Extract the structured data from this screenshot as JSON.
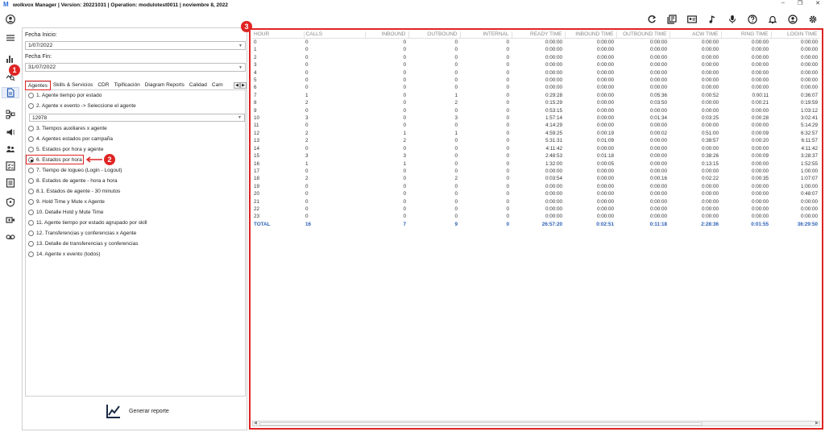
{
  "window": {
    "title": "wolkvox Manager  | Version: 20221031 |  Operation: modulotest0011  |  noviembre 8, 2022",
    "logo_letter": "M"
  },
  "toolbar_icons": [
    "refresh-icon",
    "library-icon",
    "contact-card-icon",
    "music-note-icon",
    "microphone-icon",
    "help-icon",
    "bell-icon",
    "user-icon",
    "settings-icon"
  ],
  "rail_icons": [
    "user-avatar-icon",
    "menu-icon",
    "bar-chart-icon",
    "search-analytics-icon",
    "reports-icon",
    "flow-icon",
    "megaphone-icon",
    "team-icon",
    "checklist-icon",
    "table-icon",
    "security-icon",
    "video-icon",
    "voicemail-icon"
  ],
  "filters": {
    "start_label": "Fecha Inicio:",
    "start_value": "1/07/2022",
    "end_label": "Fecha Fin:",
    "end_value": "31/07/2022"
  },
  "tabs": [
    "Agentes",
    "Skills & Servicios",
    "CDR",
    "Tipificación",
    "Diagram Reports",
    "Calidad",
    "Cam"
  ],
  "reports": {
    "options": [
      "1. Agente tiempo por estado",
      "2. Agente x evento -> Seleccione el agente",
      "3. Tiempos auxiliares x agente",
      "4. Agentes estados por campaña",
      "5. Estados por hora y agente",
      "6. Estados por hora",
      "7. Tiempo de logueo (Login - Logout)",
      "8. Estados de agente - hora a hora",
      "8.1. Estados de agente - 30 minutos",
      "9. Hold Time y Mute x Agente",
      "10. Detalle Hold y Mute Time",
      "11. Agente tiempo por estado agrupado por skill",
      "12. Transferencias y conferencias x Agente",
      "13. Detalle de transferencias y conferencias",
      "14. Agente x evento (todos)"
    ],
    "selected_index": 5,
    "agent_value": "12978"
  },
  "generate_label": "Generar reporte",
  "callouts": [
    "1",
    "2",
    "3"
  ],
  "grid": {
    "headers": [
      "HOUR",
      "CALLS",
      "INBOUND",
      "OUTBOUND",
      "INTERNAL",
      "READY TIME",
      "INBOUND TIME",
      "OUTBOUND TIME",
      "ACW TIME",
      "RING TIME",
      "LOGIN TIME"
    ],
    "rows": [
      [
        "0",
        "0",
        "0",
        "0",
        "0",
        "0:00:00",
        "0:00:00",
        "0:00:00",
        "0:00:00",
        "0:00:00",
        "0:00:00"
      ],
      [
        "1",
        "0",
        "0",
        "0",
        "0",
        "0:00:00",
        "0:00:00",
        "0:00:00",
        "0:00:00",
        "0:00:00",
        "0:00:00"
      ],
      [
        "2",
        "0",
        "0",
        "0",
        "0",
        "0:00:00",
        "0:00:00",
        "0:00:00",
        "0:00:00",
        "0:00:00",
        "0:00:00"
      ],
      [
        "3",
        "0",
        "0",
        "0",
        "0",
        "0:00:00",
        "0:00:00",
        "0:00:00",
        "0:00:00",
        "0:00:00",
        "0:00:00"
      ],
      [
        "4",
        "0",
        "0",
        "0",
        "0",
        "0:00:00",
        "0:00:00",
        "0:00:00",
        "0:00:00",
        "0:00:00",
        "0:00:00"
      ],
      [
        "5",
        "0",
        "0",
        "0",
        "0",
        "0:00:00",
        "0:00:00",
        "0:00:00",
        "0:00:00",
        "0:00:00",
        "0:00:00"
      ],
      [
        "6",
        "0",
        "0",
        "0",
        "0",
        "0:00:00",
        "0:00:00",
        "0:00:00",
        "0:00:00",
        "0:00:00",
        "0:00:00"
      ],
      [
        "7",
        "1",
        "0",
        "1",
        "0",
        "0:29:28",
        "0:00:00",
        "0:05:36",
        "0:00:52",
        "0:00:11",
        "0:36:07"
      ],
      [
        "8",
        "2",
        "0",
        "2",
        "0",
        "0:15:29",
        "0:00:00",
        "0:03:50",
        "0:00:00",
        "0:00:21",
        "0:19:59"
      ],
      [
        "9",
        "0",
        "0",
        "0",
        "0",
        "0:53:15",
        "0:00:00",
        "0:00:00",
        "0:00:00",
        "0:00:00",
        "1:03:12"
      ],
      [
        "10",
        "3",
        "0",
        "3",
        "0",
        "1:57:14",
        "0:00:00",
        "0:01:34",
        "0:03:25",
        "0:00:28",
        "3:02:41"
      ],
      [
        "11",
        "0",
        "0",
        "0",
        "0",
        "4:14:29",
        "0:00:00",
        "0:00:00",
        "0:00:00",
        "0:00:00",
        "5:14:29"
      ],
      [
        "12",
        "2",
        "1",
        "1",
        "0",
        "4:59:25",
        "0:00:19",
        "0:00:02",
        "0:51:00",
        "0:00:09",
        "6:32:57"
      ],
      [
        "13",
        "2",
        "2",
        "0",
        "0",
        "5:31:31",
        "0:01:09",
        "0:00:00",
        "0:38:57",
        "0:00:20",
        "6:11:57"
      ],
      [
        "14",
        "0",
        "0",
        "0",
        "0",
        "4:11:42",
        "0:00:00",
        "0:00:00",
        "0:00:00",
        "0:00:00",
        "4:11:42"
      ],
      [
        "15",
        "3",
        "3",
        "0",
        "0",
        "2:48:53",
        "0:01:18",
        "0:00:00",
        "0:38:26",
        "0:00:09",
        "3:28:37"
      ],
      [
        "16",
        "1",
        "1",
        "0",
        "0",
        "1:32:00",
        "0:00:05",
        "0:00:00",
        "0:13:15",
        "0:00:00",
        "1:52:55"
      ],
      [
        "17",
        "0",
        "0",
        "0",
        "0",
        "0:00:00",
        "0:00:00",
        "0:00:00",
        "0:00:00",
        "0:00:00",
        "1:00:00"
      ],
      [
        "18",
        "2",
        "0",
        "2",
        "0",
        "0:03:54",
        "0:00:00",
        "0:00:16",
        "0:02:22",
        "0:00:35",
        "1:07:07"
      ],
      [
        "19",
        "0",
        "0",
        "0",
        "0",
        "0:00:00",
        "0:00:00",
        "0:00:00",
        "0:00:00",
        "0:00:00",
        "1:00:00"
      ],
      [
        "20",
        "0",
        "0",
        "0",
        "0",
        "0:00:00",
        "0:00:00",
        "0:00:00",
        "0:00:00",
        "0:00:00",
        "0:48:07"
      ],
      [
        "21",
        "0",
        "0",
        "0",
        "0",
        "0:00:00",
        "0:00:00",
        "0:00:00",
        "0:00:00",
        "0:00:00",
        "0:00:00"
      ],
      [
        "22",
        "0",
        "0",
        "0",
        "0",
        "0:00:00",
        "0:00:00",
        "0:00:00",
        "0:00:00",
        "0:00:00",
        "0:00:00"
      ],
      [
        "23",
        "0",
        "0",
        "0",
        "0",
        "0:00:00",
        "0:00:00",
        "0:00:00",
        "0:00:00",
        "0:00:00",
        "0:00:00"
      ]
    ],
    "total": [
      "TOTAL",
      "16",
      "7",
      "9",
      "0",
      "26:57:20",
      "0:02:51",
      "0:11:18",
      "2:28:36",
      "0:01:55",
      "36:29:50"
    ]
  },
  "colors": {
    "accent": "#e02424",
    "total_text": "#2a5fb5",
    "header_text": "#888888"
  }
}
